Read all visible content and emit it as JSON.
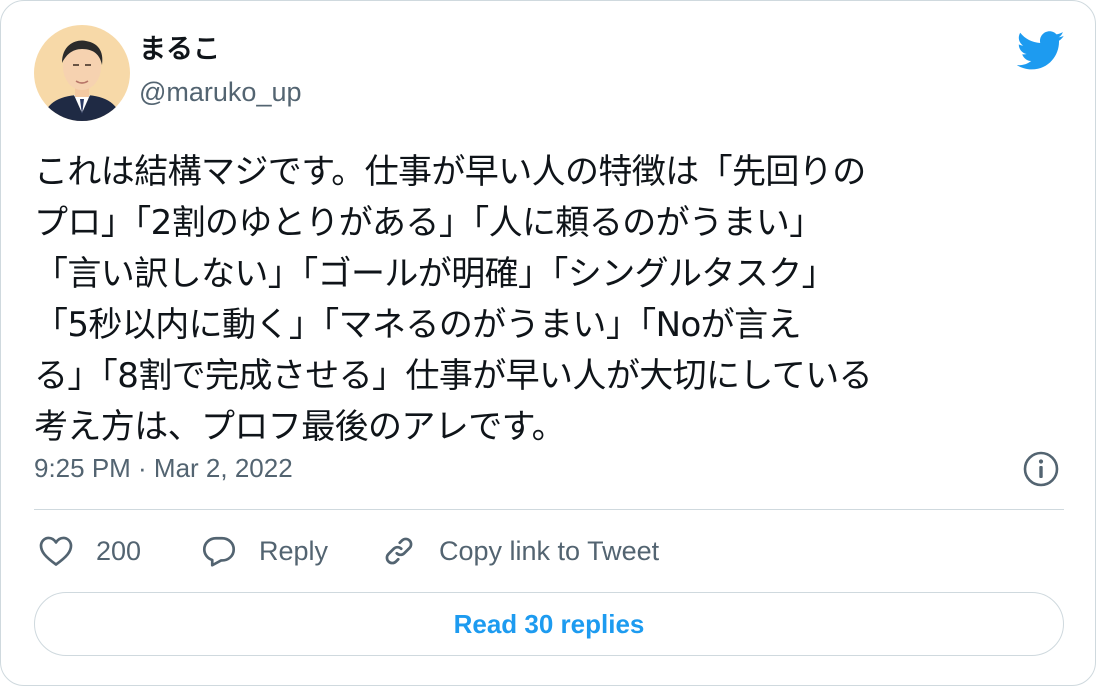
{
  "author": {
    "display_name": "まるこ",
    "handle": "@maruko_up"
  },
  "tweet": {
    "lines": [
      "これは結構マジです。仕事が早い人の特徴は「先回りの",
      "プロ」「2割のゆとりがある」「人に頼るのがうまい」",
      "「言い訳しない」「ゴールが明確」「シングルタスク」",
      "「5秒以内に動く」「マネるのがうまい」「Noが言え",
      "る」「8割で完成させる」仕事が早い人が大切にしている",
      "考え方は、プロフ最後のアレです。"
    ],
    "timestamp": "9:25 PM · Mar 2, 2022"
  },
  "actions": {
    "like_count": "200",
    "reply_label": "Reply",
    "copy_link_label": "Copy link to Tweet"
  },
  "footer": {
    "read_replies_label": "Read 30 replies"
  },
  "colors": {
    "brand_blue": "#1d9bf0",
    "text_primary": "#0f1419",
    "text_secondary": "#536471",
    "border": "#cfd9de"
  },
  "icons": {
    "logo": "twitter-bird-icon",
    "info": "info-icon",
    "like": "heart-icon",
    "reply": "speech-bubble-icon",
    "copy_link": "link-icon"
  }
}
